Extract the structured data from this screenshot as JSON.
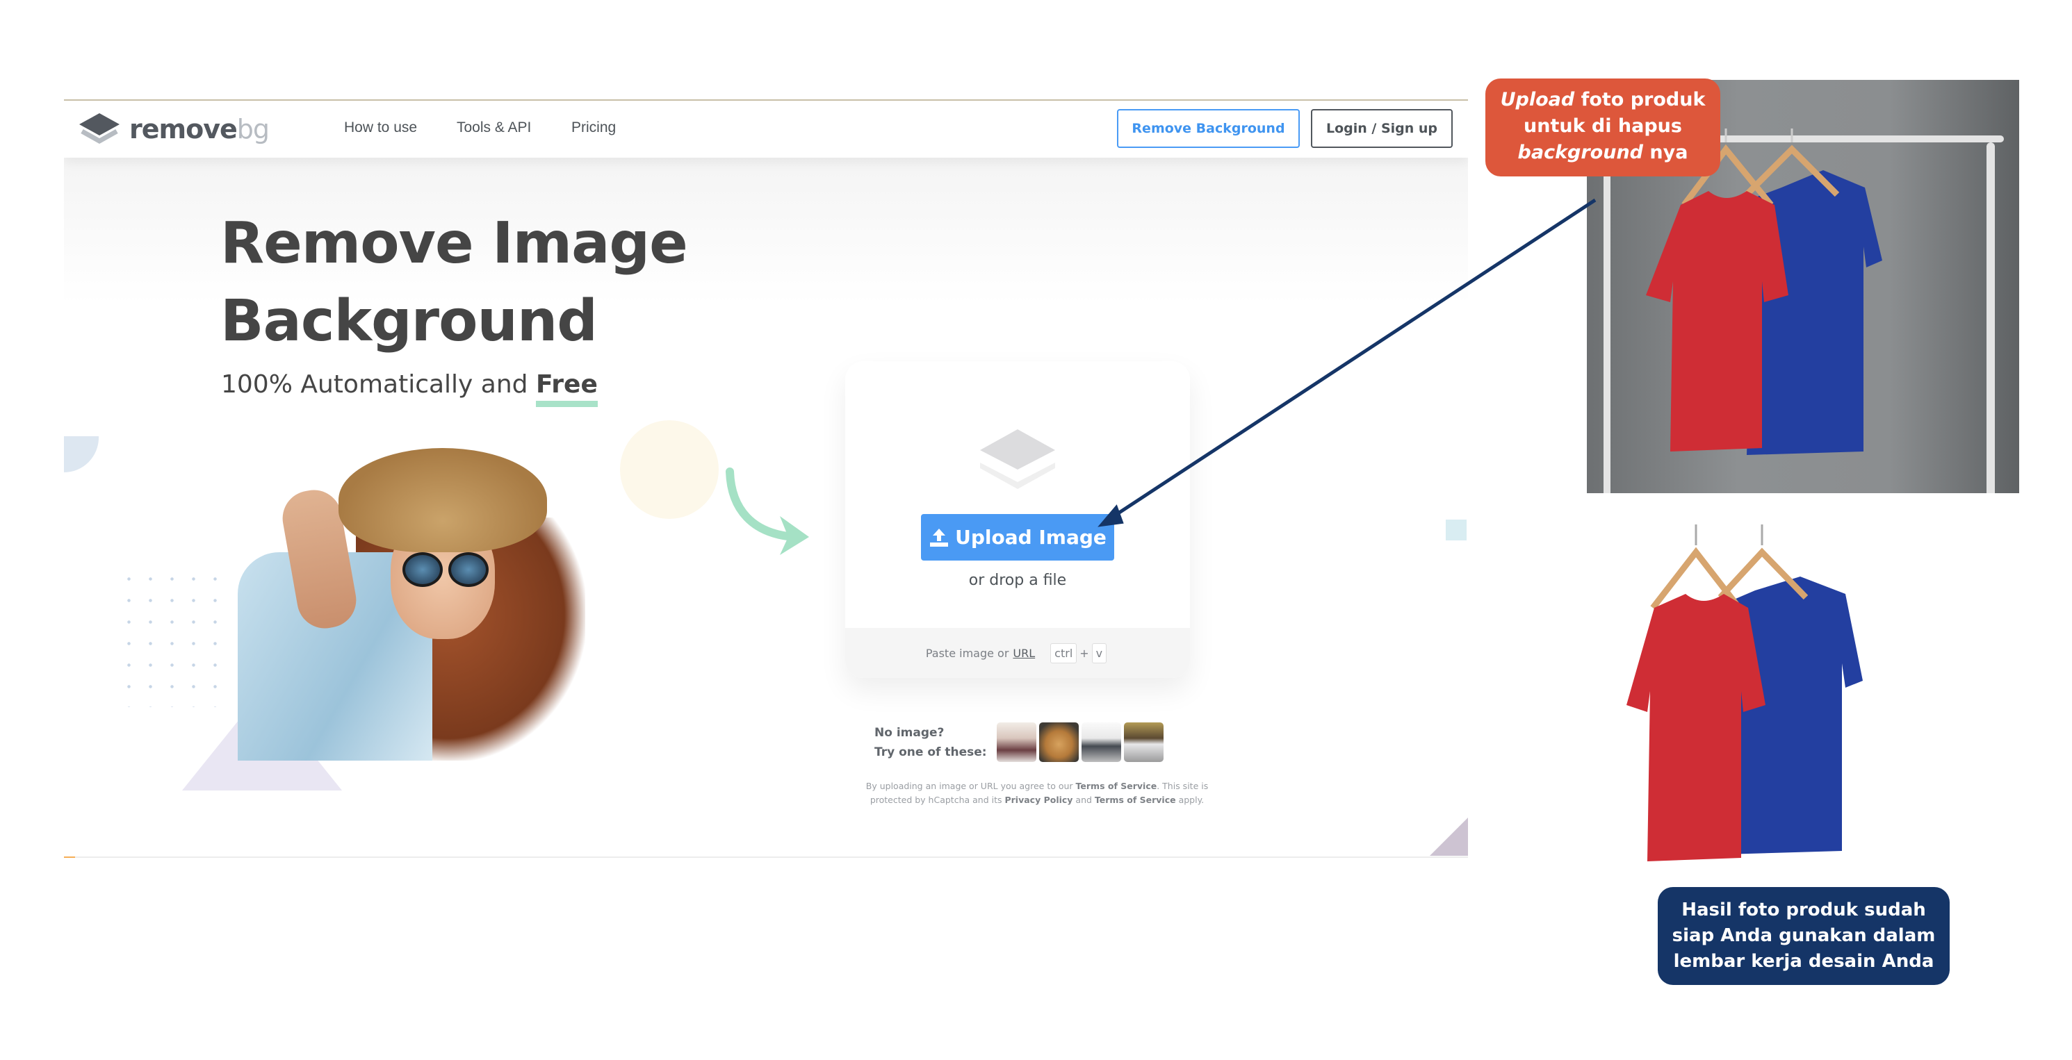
{
  "site": {
    "logo": {
      "primary": "remove",
      "secondary": "bg"
    },
    "nav_links": [
      "How to use",
      "Tools & API",
      "Pricing"
    ],
    "buttons": {
      "remove_background": "Remove Background",
      "login": "Login / Sign up"
    },
    "hero": {
      "headline_line1": "Remove Image",
      "headline_line2": "Background",
      "subtitle_prefix": "100% Automatically and ",
      "subtitle_emphasis": "Free"
    },
    "upload_card": {
      "button_label": "Upload Image",
      "drop_text": "or drop a file",
      "paste_prefix": "Paste image or",
      "paste_link": "URL",
      "shortcut_key1": "ctrl",
      "shortcut_plus": "+",
      "shortcut_key2": "v"
    },
    "samples": {
      "line1": "No image?",
      "line2": "Try one of these:",
      "thumbnails": [
        "woman",
        "dog",
        "laptop",
        "car"
      ]
    },
    "terms": {
      "part1": "By uploading an image or URL you agree to our ",
      "tos1": "Terms of Service",
      "part2": ". This site is protected by hCaptcha and its ",
      "privacy": "Privacy Policy",
      "part3": " and ",
      "tos2": "Terms of Service",
      "part4": " apply."
    }
  },
  "annotations": {
    "top_callout": {
      "italic1": "Upload",
      "text1": " foto produk",
      "line2": "untuk di hapus",
      "italic3": "background",
      "text3": " nya"
    },
    "bottom_callout": {
      "line1": "Hasil foto produk sudah",
      "line2": "siap Anda gunakan dalam",
      "line3": "lembar kerja desain Anda"
    },
    "colors": {
      "top_callout": "#dd573b",
      "bottom_callout": "#153567",
      "accent_blue": "#4a9af4",
      "arrow": "#153567"
    }
  }
}
